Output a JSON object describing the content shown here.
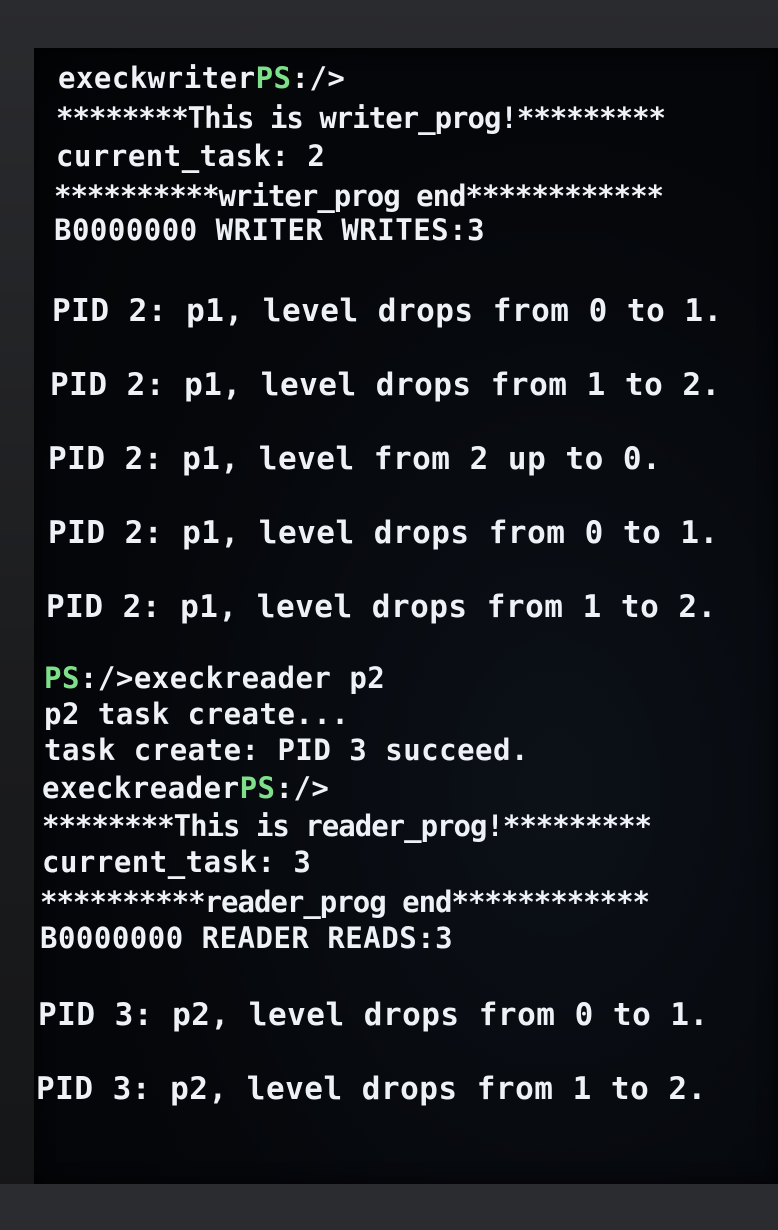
{
  "terminal": {
    "prompt": "PS",
    "prompt_suffix": ":/>",
    "lines": {
      "l1_cmd": "execkwriter",
      "l2": "********This is writer_prog!*********",
      "l3": "current_task: 2",
      "l4": "**********writer_prog end************",
      "l5": "B0000000 WRITER WRITES:3",
      "l6": "PID 2: p1, level drops from 0 to 1.",
      "l7": "PID 2: p1, level drops from 1 to 2.",
      "l8": "PID 2: p1, level from 2 up to 0.",
      "l9": "PID 2: p1, level drops from 0 to 1.",
      "l10": "PID 2: p1, level drops from 1 to 2.",
      "l11_cmd": "execkreader p2",
      "l12": "p2 task create...",
      "l13": "task create: PID 3 succeed.",
      "l14_cmd": "execkreader",
      "l15": "********This is reader_prog!*********",
      "l16": "current_task: 3",
      "l17": "**********reader_prog end************",
      "l18": "B0000000 READER READS:3",
      "l19": "PID 3: p2, level drops from 0 to 1.",
      "l20": "PID 3: p2, level drops from 1 to 2."
    }
  }
}
